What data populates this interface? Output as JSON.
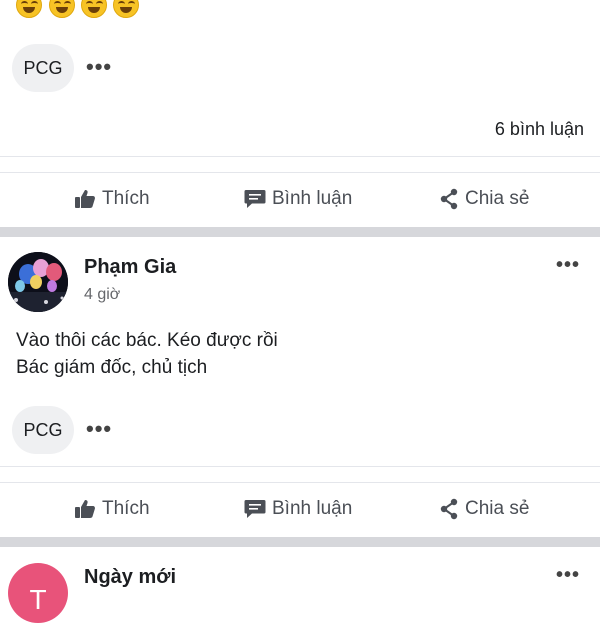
{
  "post1": {
    "tag_chip": "PCG",
    "more_label": "•••",
    "comment_count": "6 bình luận",
    "actions": {
      "like": "Thích",
      "comment": "Bình luận",
      "share": "Chia sẻ"
    }
  },
  "post2": {
    "author": "Phạm Gia",
    "time": "4 giờ",
    "text_line1": "Vào thôi các bác. Kéo được rồi",
    "text_line2": "Bác giám đốc, chủ tịch",
    "tag_chip": "PCG",
    "more_label": "•••",
    "actions": {
      "like": "Thích",
      "comment": "Bình luận",
      "share": "Chia sẻ"
    }
  },
  "post3": {
    "author": "Ngày mới",
    "avatar_letter": "T",
    "avatar_color": "#e8537a",
    "more_label": "•••"
  },
  "colors": {
    "divider": "#e4e6eb",
    "section_gap": "#d6d7db",
    "action_text": "#4b4f56"
  }
}
